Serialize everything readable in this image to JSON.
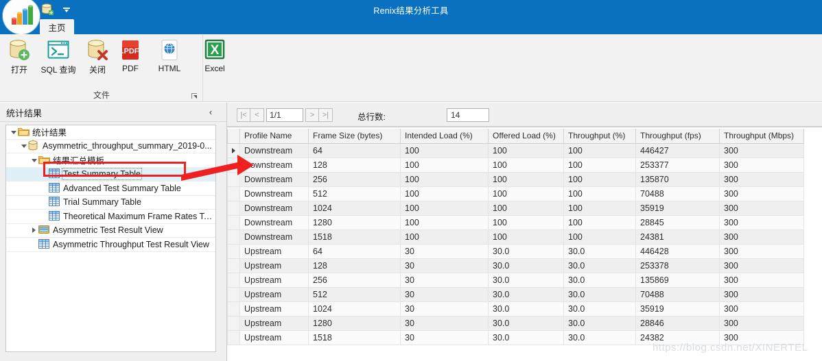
{
  "window": {
    "title": "Renix结果分析工具"
  },
  "quick_access": {
    "open_icon": "database-add-icon",
    "customize_icon": "chevron-down-icon"
  },
  "ribbon": {
    "tabs": [
      {
        "label": "主页",
        "active": true
      }
    ],
    "group_title": "文件",
    "dialog_launcher_icon": "dialog-launcher-icon",
    "buttons": [
      {
        "label": "打开",
        "icon": "database-add-icon"
      },
      {
        "label": "SQL 查询",
        "icon": "sql-console-icon"
      },
      {
        "label": "关闭",
        "icon": "database-close-icon"
      },
      {
        "label": "PDF",
        "icon": "pdf-icon"
      },
      {
        "label": "HTML",
        "icon": "html-globe-icon"
      },
      {
        "label": "Excel",
        "icon": "excel-icon"
      }
    ]
  },
  "left_panel": {
    "title": "统计结果",
    "collapse_icon": "chevron-left-icon",
    "tree": [
      {
        "label": "统计结果",
        "icon": "folder-icon",
        "indent": 0,
        "expander": "open",
        "selected": false
      },
      {
        "label": "Asymmetric_throughput_summary_2019-0...",
        "icon": "database-icon",
        "indent": 1,
        "expander": "open",
        "selected": false
      },
      {
        "label": "结果汇总模板",
        "icon": "folder-icon",
        "indent": 2,
        "expander": "open",
        "selected": false
      },
      {
        "label": "Test Summary Table",
        "icon": "grid-icon",
        "indent": 3,
        "expander": "none",
        "selected": true
      },
      {
        "label": "Advanced Test Summary Table",
        "icon": "grid-icon",
        "indent": 3,
        "expander": "none",
        "selected": false
      },
      {
        "label": "Trial Summary Table",
        "icon": "grid-icon",
        "indent": 3,
        "expander": "none",
        "selected": false
      },
      {
        "label": "Theoretical Maximum Frame Rates Ta...",
        "icon": "grid-icon",
        "indent": 3,
        "expander": "none",
        "selected": false
      },
      {
        "label": "Asymmetric Test Result View",
        "icon": "view-icon",
        "indent": 2,
        "expander": "closed",
        "selected": false
      },
      {
        "label": "Asymmetric Throughput Test Result View",
        "icon": "grid-icon",
        "indent": 2,
        "expander": "none",
        "selected": false
      }
    ]
  },
  "annotation": {
    "highlight_color": "#ef2020",
    "arrow_icon": "red-arrow-icon"
  },
  "toolbar": {
    "first_page_label": "|<",
    "prev_page_label": "<",
    "page_value": "1/1",
    "next_page_label": ">",
    "last_page_label": ">|",
    "total_rows_label": "总行数:",
    "total_rows_value": "14"
  },
  "table": {
    "columns": [
      "Profile Name",
      "Frame Size (bytes)",
      "Intended Load (%)",
      "Offered Load (%)",
      "Throughput (%)",
      "Throughput (fps)",
      "Throughput (Mbps)"
    ],
    "rows": [
      [
        "Downstream",
        "64",
        "100",
        "100",
        "100",
        "446427",
        "300"
      ],
      [
        "Downstream",
        "128",
        "100",
        "100",
        "100",
        "253377",
        "300"
      ],
      [
        "Downstream",
        "256",
        "100",
        "100",
        "100",
        "135870",
        "300"
      ],
      [
        "Downstream",
        "512",
        "100",
        "100",
        "100",
        "70488",
        "300"
      ],
      [
        "Downstream",
        "1024",
        "100",
        "100",
        "100",
        "35919",
        "300"
      ],
      [
        "Downstream",
        "1280",
        "100",
        "100",
        "100",
        "28845",
        "300"
      ],
      [
        "Downstream",
        "1518",
        "100",
        "100",
        "100",
        "24381",
        "300"
      ],
      [
        "Upstream",
        "64",
        "30",
        "30.0",
        "30.0",
        "446428",
        "300"
      ],
      [
        "Upstream",
        "128",
        "30",
        "30.0",
        "30.0",
        "253378",
        "300"
      ],
      [
        "Upstream",
        "256",
        "30",
        "30.0",
        "30.0",
        "135869",
        "300"
      ],
      [
        "Upstream",
        "512",
        "30",
        "30.0",
        "30.0",
        "70488",
        "300"
      ],
      [
        "Upstream",
        "1024",
        "30",
        "30.0",
        "30.0",
        "35919",
        "300"
      ],
      [
        "Upstream",
        "1280",
        "30",
        "30.0",
        "30.0",
        "28846",
        "300"
      ],
      [
        "Upstream",
        "1518",
        "30",
        "30.0",
        "30.0",
        "24382",
        "300"
      ]
    ],
    "current_row_index": 0,
    "current_row_marker_icon": "row-cursor-icon"
  },
  "watermark": {
    "text": "https://blog.csdn.net/XINERTEL"
  }
}
